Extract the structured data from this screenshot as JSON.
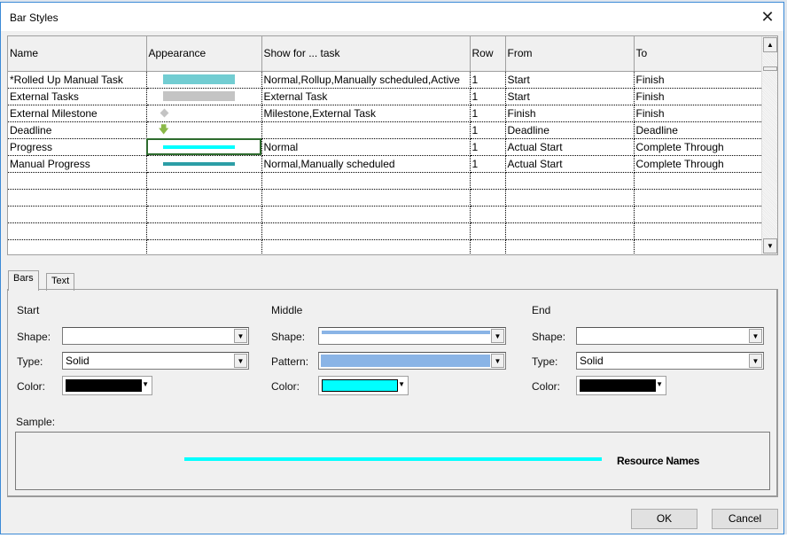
{
  "window": {
    "title": "Bar Styles",
    "close_icon": "close-icon"
  },
  "grid": {
    "columns": [
      "Name",
      "Appearance",
      "Show for ... task",
      "Row",
      "From",
      "To"
    ],
    "rows": [
      {
        "name": "*Rolled Up Manual Task",
        "appearance": "bar",
        "appearance_color": "#72cdd2",
        "show_for": "Normal,Rollup,Manually scheduled,Active",
        "row": "1",
        "from": "Start",
        "to": "Finish"
      },
      {
        "name": "External Tasks",
        "appearance": "bar",
        "appearance_color": "#c4c4c4",
        "show_for": "External Task",
        "row": "1",
        "from": "Start",
        "to": "Finish"
      },
      {
        "name": "External Milestone",
        "appearance": "diamond",
        "appearance_color": "#c4c4c4",
        "show_for": "Milestone,External Task",
        "row": "1",
        "from": "Finish",
        "to": "Finish"
      },
      {
        "name": "Deadline",
        "appearance": "down-arrow",
        "appearance_color": "#8ab848",
        "show_for": "",
        "row": "1",
        "from": "Deadline",
        "to": "Deadline"
      },
      {
        "name": "Progress",
        "appearance": "thin-bar",
        "appearance_color": "#00ffff",
        "show_for": "Normal",
        "row": "1",
        "from": "Actual Start",
        "to": "Complete Through"
      },
      {
        "name": "Manual Progress",
        "appearance": "thin-bar",
        "appearance_color": "#2c9ea6",
        "show_for": "Normal,Manually scheduled",
        "row": "1",
        "from": "Actual Start",
        "to": "Complete Through"
      }
    ],
    "empty_rows": 5,
    "selected_row": 4
  },
  "tabs": [
    {
      "label": "Bars",
      "active": true
    },
    {
      "label": "Text",
      "active": false
    }
  ],
  "bars": {
    "start": {
      "heading": "Start",
      "shape_label": "Shape:",
      "shape_value": "",
      "type_label": "Type:",
      "type_value": "Solid",
      "color_label": "Color:",
      "color": "#000000"
    },
    "middle": {
      "heading": "Middle",
      "shape_label": "Shape:",
      "shape_color": "#8ab4e6",
      "pattern_label": "Pattern:",
      "pattern_color": "#8ab4e6",
      "color_label": "Color:",
      "color": "#00ffff"
    },
    "end": {
      "heading": "End",
      "shape_label": "Shape:",
      "shape_value": "",
      "type_label": "Type:",
      "type_value": "Solid",
      "color_label": "Color:",
      "color": "#000000"
    }
  },
  "sample": {
    "label": "Sample:",
    "bar_color": "#00ffff",
    "text": "Resource Names"
  },
  "buttons": {
    "ok": "OK",
    "cancel": "Cancel"
  }
}
